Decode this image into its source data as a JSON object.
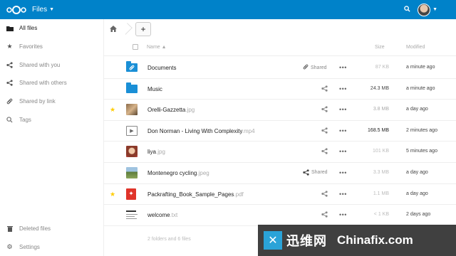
{
  "header": {
    "app_title": "Files"
  },
  "sidebar": {
    "items": [
      {
        "label": "All files",
        "icon": "folder-icon",
        "active": true
      },
      {
        "label": "Favorites",
        "icon": "star-icon"
      },
      {
        "label": "Shared with you",
        "icon": "share-icon"
      },
      {
        "label": "Shared with others",
        "icon": "share-icon"
      },
      {
        "label": "Shared by link",
        "icon": "link-icon"
      },
      {
        "label": "Tags",
        "icon": "tag-icon"
      }
    ],
    "bottom": [
      {
        "label": "Deleted files",
        "icon": "trash-icon"
      },
      {
        "label": "Settings",
        "icon": "gear-icon"
      }
    ]
  },
  "table": {
    "header": {
      "name": "Name",
      "size": "Size",
      "modified": "Modified"
    },
    "rows": [
      {
        "name": "Documents",
        "ext": "",
        "size": "87 KB",
        "modified": "a minute ago",
        "shared_label": "Shared",
        "favorite": false,
        "type": "folder-shared"
      },
      {
        "name": "Music",
        "ext": "",
        "size": "24.3 MB",
        "modified": "a minute ago",
        "shared_label": "",
        "favorite": false,
        "type": "folder"
      },
      {
        "name": "Orelli-Gazzetta",
        "ext": ".jpg",
        "size": "3.8 MB",
        "modified": "a day ago",
        "shared_label": "",
        "favorite": true,
        "type": "image"
      },
      {
        "name": "Don Norman - Living With Complexity",
        "ext": ".mp4",
        "size": "168.5 MB",
        "modified": "2 minutes ago",
        "shared_label": "",
        "favorite": false,
        "type": "video"
      },
      {
        "name": "liya",
        "ext": ".jpg",
        "size": "101 KB",
        "modified": "5 minutes ago",
        "shared_label": "",
        "favorite": false,
        "type": "image"
      },
      {
        "name": "Montenegro cycling",
        "ext": ".jpeg",
        "size": "3.3 MB",
        "modified": "a day ago",
        "shared_label": "Shared",
        "favorite": false,
        "type": "image"
      },
      {
        "name": "Packrafting_Book_Sample_Pages",
        "ext": ".pdf",
        "size": "1.1 MB",
        "modified": "a day ago",
        "shared_label": "",
        "favorite": true,
        "type": "pdf"
      },
      {
        "name": "welcome",
        "ext": ".txt",
        "size": "< 1 KB",
        "modified": "2 days ago",
        "shared_label": "",
        "favorite": false,
        "type": "text"
      }
    ],
    "summary": "2 folders and 6 files"
  },
  "watermark": {
    "brand_cn": "迅维网",
    "brand_en": "Chinafix.com"
  },
  "colors": {
    "header_bg": "#0082c9",
    "folder": "#1a8fd6",
    "star": "#ffcc00"
  }
}
